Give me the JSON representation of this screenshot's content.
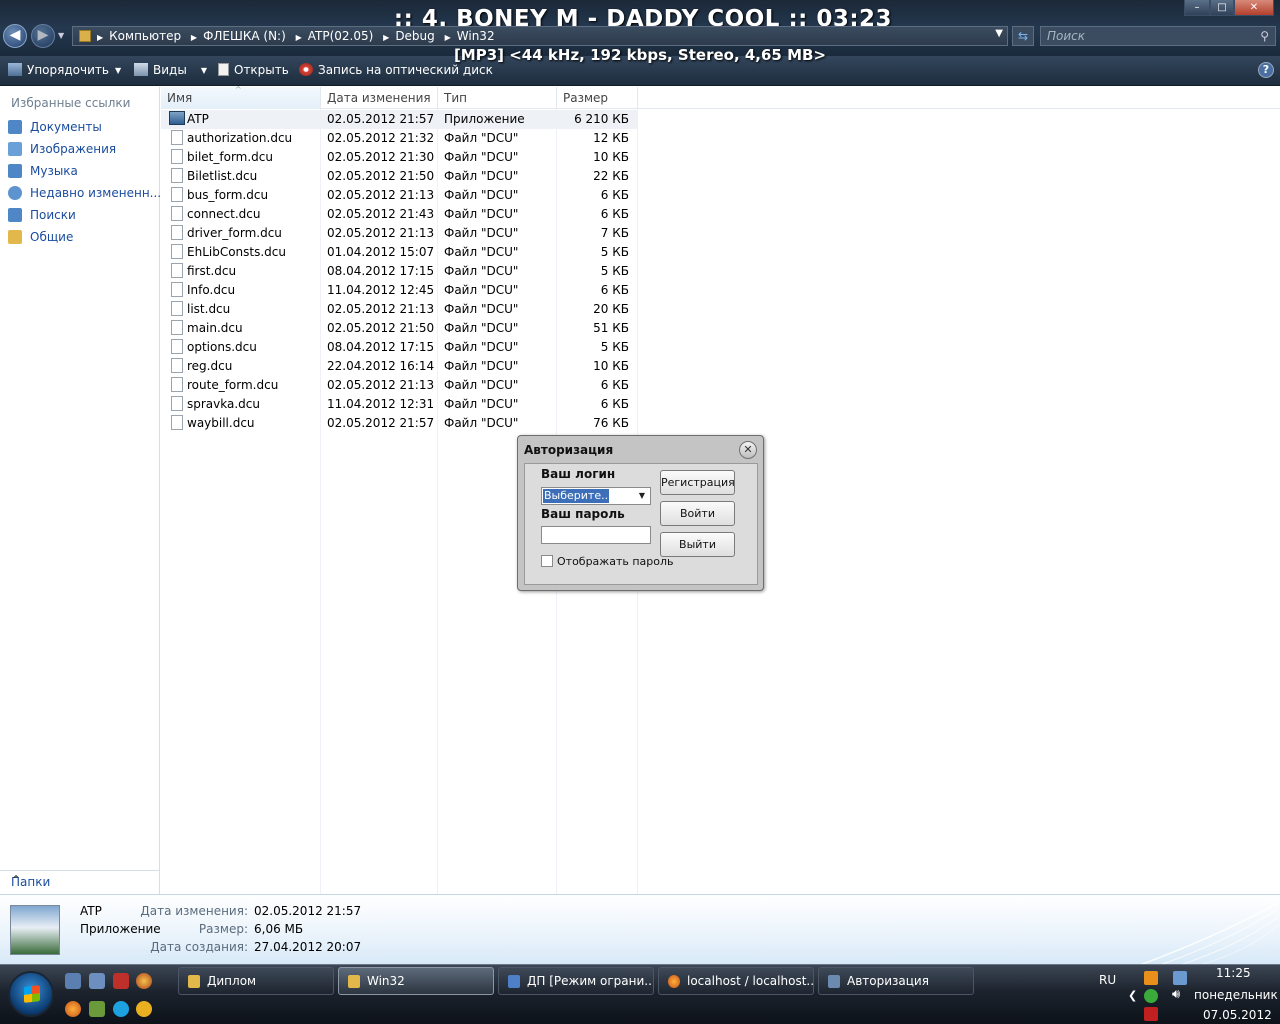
{
  "osd": {
    "title": ":: 4. BONEY M - DADDY COOL :: 03:23",
    "sub": "[MP3] <44 kHz, 192 kbps, Stereo, 4,65 MB>"
  },
  "window": {
    "minimize": "–",
    "maximize": "□",
    "close": "✕"
  },
  "address": {
    "crumbs": [
      "Компьютер",
      "ФЛЕШКА (N:)",
      "ATP(02.05)",
      "Debug",
      "Win32"
    ],
    "search_placeholder": "Поиск"
  },
  "toolbar": {
    "organize": "Упорядочить",
    "views": "Виды",
    "open": "Открыть",
    "burn": "Запись на оптический диск",
    "help": "?"
  },
  "nav": {
    "fav_title": "Избранные ссылки",
    "items": [
      "Документы",
      "Изображения",
      "Музыка",
      "Недавно измененн...",
      "Поиски",
      "Общие"
    ],
    "folders": "Папки"
  },
  "columns": {
    "name": "Имя",
    "date": "Дата изменения",
    "type": "Тип",
    "size": "Размер"
  },
  "files": [
    {
      "name": "ATP",
      "date": "02.05.2012 21:57",
      "type": "Приложение",
      "size": "6 210 КБ"
    },
    {
      "name": "authorization.dcu",
      "date": "02.05.2012 21:32",
      "type": "Файл \"DCU\"",
      "size": "12 КБ"
    },
    {
      "name": "bilet_form.dcu",
      "date": "02.05.2012 21:30",
      "type": "Файл \"DCU\"",
      "size": "10 КБ"
    },
    {
      "name": "Biletlist.dcu",
      "date": "02.05.2012 21:50",
      "type": "Файл \"DCU\"",
      "size": "22 КБ"
    },
    {
      "name": "bus_form.dcu",
      "date": "02.05.2012 21:13",
      "type": "Файл \"DCU\"",
      "size": "6 КБ"
    },
    {
      "name": "connect.dcu",
      "date": "02.05.2012 21:43",
      "type": "Файл \"DCU\"",
      "size": "6 КБ"
    },
    {
      "name": "driver_form.dcu",
      "date": "02.05.2012 21:13",
      "type": "Файл \"DCU\"",
      "size": "7 КБ"
    },
    {
      "name": "EhLibConsts.dcu",
      "date": "01.04.2012 15:07",
      "type": "Файл \"DCU\"",
      "size": "5 КБ"
    },
    {
      "name": "first.dcu",
      "date": "08.04.2012 17:15",
      "type": "Файл \"DCU\"",
      "size": "5 КБ"
    },
    {
      "name": "Info.dcu",
      "date": "11.04.2012 12:45",
      "type": "Файл \"DCU\"",
      "size": "6 КБ"
    },
    {
      "name": "list.dcu",
      "date": "02.05.2012 21:13",
      "type": "Файл \"DCU\"",
      "size": "20 КБ"
    },
    {
      "name": "main.dcu",
      "date": "02.05.2012 21:50",
      "type": "Файл \"DCU\"",
      "size": "51 КБ"
    },
    {
      "name": "options.dcu",
      "date": "08.04.2012 17:15",
      "type": "Файл \"DCU\"",
      "size": "5 КБ"
    },
    {
      "name": "reg.dcu",
      "date": "22.04.2012 16:14",
      "type": "Файл \"DCU\"",
      "size": "10 КБ"
    },
    {
      "name": "route_form.dcu",
      "date": "02.05.2012 21:13",
      "type": "Файл \"DCU\"",
      "size": "6 КБ"
    },
    {
      "name": "spravka.dcu",
      "date": "11.04.2012 12:31",
      "type": "Файл \"DCU\"",
      "size": "6 КБ"
    },
    {
      "name": "waybill.dcu",
      "date": "02.05.2012 21:57",
      "type": "Файл \"DCU\"",
      "size": "76 КБ"
    }
  ],
  "details": {
    "name": "ATP",
    "kind": "Приложение",
    "modified_label": "Дата изменения:",
    "modified": "02.05.2012 21:57",
    "size_label": "Размер:",
    "size": "6,06 МБ",
    "created_label": "Дата создания:",
    "created": "27.04.2012 20:07"
  },
  "dialog": {
    "title": "Авторизация",
    "login_label": "Ваш логин",
    "login_value": "Выберите..",
    "password_label": "Ваш пароль",
    "show_password": "Отображать пароль",
    "register": "Регистрация",
    "enter": "Войти",
    "exit": "Выйти"
  },
  "taskbar": {
    "tasks": [
      "Диплом",
      "Win32",
      "ДП [Режим ограни...",
      "localhost / localhost...",
      "Авторизация"
    ],
    "lang": "RU",
    "time": "11:25",
    "day": "понедельник",
    "date": "07.05.2012"
  }
}
